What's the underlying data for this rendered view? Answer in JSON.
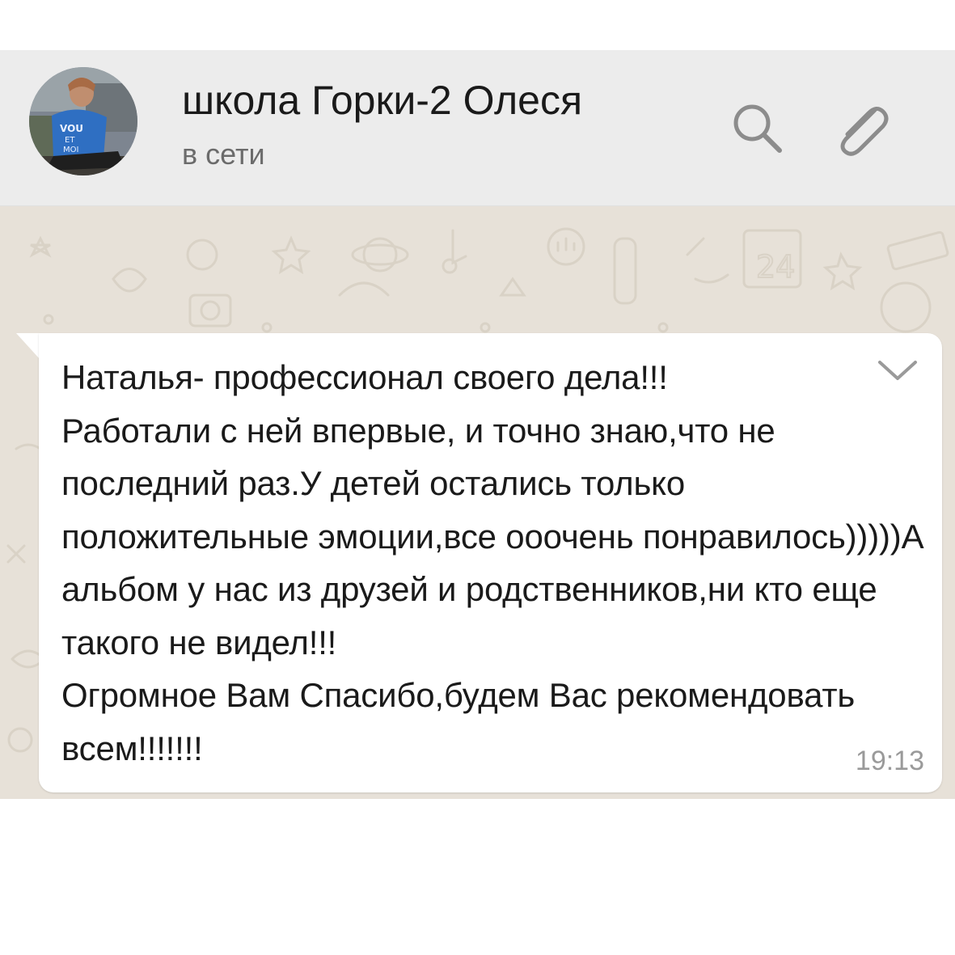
{
  "header": {
    "contact_name": "школа Горки-2 Олеся",
    "status": "в сети",
    "icons": [
      "search-icon",
      "paperclip-icon"
    ]
  },
  "message": {
    "text": "Наталья- профессионал своего дела!!!\nРаботали с ней впервые, и точно знаю,что не последний раз.У детей остались только положительные эмоции,все ооочень понравилось)))))А альбом у нас из друзей и родственников,ни кто еще такого не видел!!!\nОгромное Вам Спасибо,будем Вас рекомендовать всем!!!!!!!",
    "time": "19:13",
    "menu_icon": "chevron-down-icon"
  },
  "colors": {
    "header_bg": "#ececec",
    "chat_bg": "#e7e1d8",
    "bubble_bg": "#ffffff",
    "icon_gray": "#8c8c8c",
    "avatar_shirt": "#2f6fc2"
  }
}
